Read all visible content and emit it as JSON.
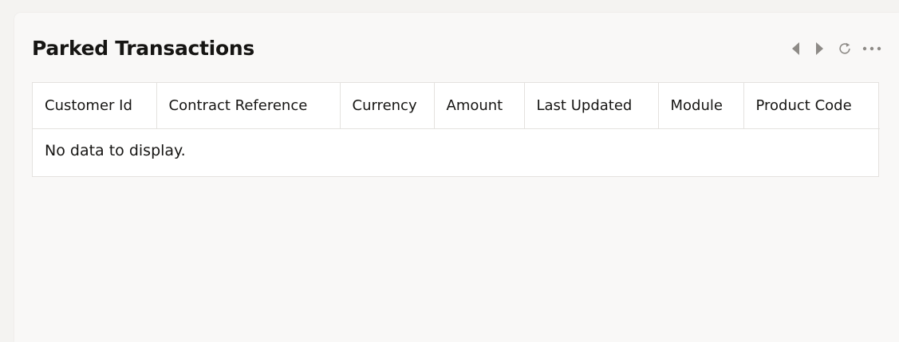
{
  "panel": {
    "title": "Parked Transactions"
  },
  "toolbar": {
    "icons": [
      "chevron-left-icon",
      "chevron-right-icon",
      "refresh-icon",
      "more-options-icon"
    ]
  },
  "table": {
    "columns": [
      {
        "key": "customer_id",
        "label": "Customer Id"
      },
      {
        "key": "contract_reference",
        "label": "Contract Reference"
      },
      {
        "key": "currency",
        "label": "Currency"
      },
      {
        "key": "amount",
        "label": "Amount"
      },
      {
        "key": "last_updated",
        "label": "Last Updated"
      },
      {
        "key": "module",
        "label": "Module"
      },
      {
        "key": "product_code",
        "label": "Product Code"
      }
    ],
    "rows": [],
    "empty_text": "No data to display."
  },
  "colors": {
    "icon": "#8e8b87",
    "text": "#161513",
    "border": "#e4e2df"
  }
}
